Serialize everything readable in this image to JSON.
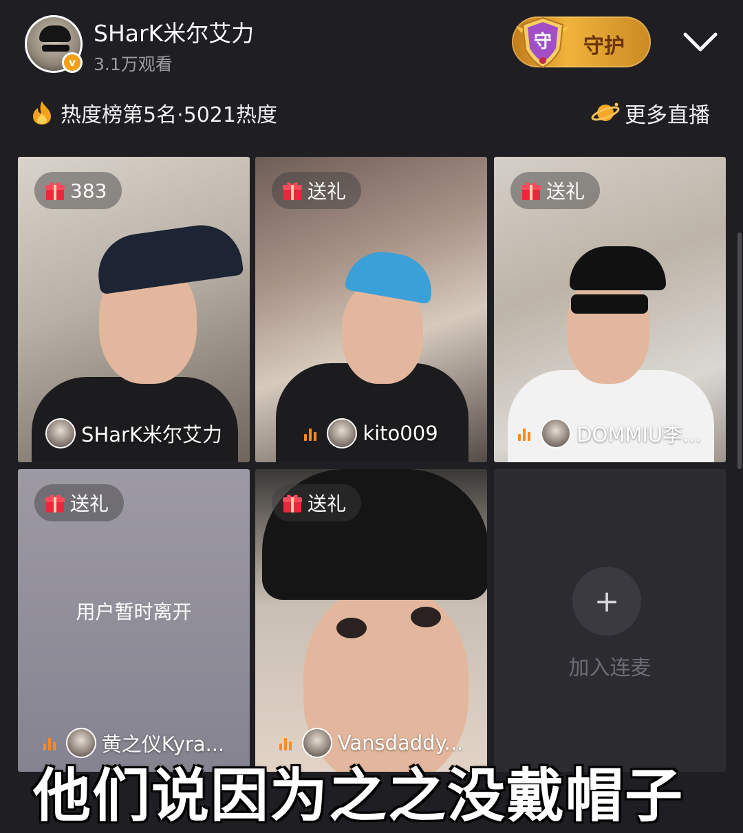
{
  "header": {
    "host_name": "SHarK米尔艾力",
    "viewers": "3.1万观看",
    "guard_label": "守护",
    "guard_badge": "守",
    "hot_rank": "热度榜第5名·5021热度",
    "more_live": "更多直播"
  },
  "tiles": [
    {
      "gift_label": "383",
      "name": "SHarK米尔艾力"
    },
    {
      "gift_label": "送礼",
      "name": "kito009"
    },
    {
      "gift_label": "送礼",
      "name": "DOMMIU李..."
    },
    {
      "gift_label": "送礼",
      "name": "黄之仪Kyra...",
      "status": "用户暂时离开"
    },
    {
      "gift_label": "送礼",
      "name": "Vansdaddy..."
    },
    {
      "join_symbol": "+",
      "join_label": "加入连麦"
    }
  ],
  "subtitle": "他们说因为之之没戴帽子",
  "colors": {
    "background": "#1f1f23",
    "guard_gold": "#f0b33a",
    "mic_active": "#ff8a1f",
    "gift_red": "#e8283c"
  }
}
